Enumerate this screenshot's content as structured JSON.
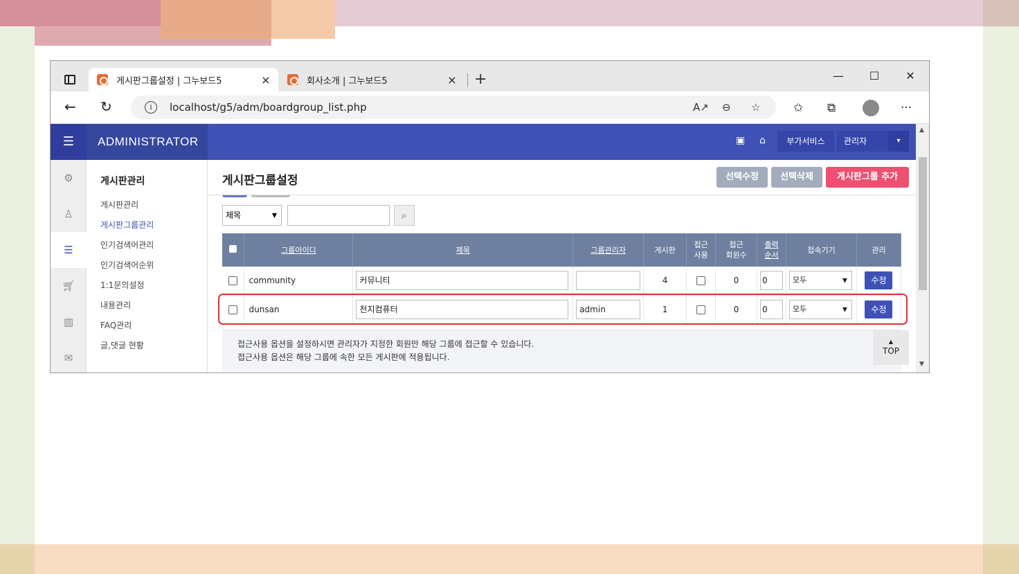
{
  "browser": {
    "tabs": [
      {
        "title": "게시판그룹설정 | 그누보드5",
        "close": "×"
      },
      {
        "title": "회사소개 | 그누보드5",
        "close": "×"
      }
    ],
    "new_tab": "+",
    "window_controls": {
      "minimize": "—",
      "maximize": "☐",
      "close": "✕"
    },
    "url": "localhost/g5/adm/boardgroup_list.php",
    "info_icon": "i"
  },
  "header": {
    "brand": "ADMINISTRATOR",
    "menu_icon": "☰",
    "addon_services": "부가서비스",
    "admin_menu": "관리자",
    "caret": "▾"
  },
  "sidebar": {
    "title": "게시판관리",
    "items": [
      {
        "label": "게시판관리"
      },
      {
        "label": "게시판그룹관리"
      },
      {
        "label": "인기검색어관리"
      },
      {
        "label": "인기검색어순위"
      },
      {
        "label": "1:1문의설정"
      },
      {
        "label": "내용관리"
      },
      {
        "label": "FAQ관리"
      },
      {
        "label": "글,댓글 현황"
      }
    ]
  },
  "main": {
    "title": "게시판그룹설정",
    "buttons": {
      "select_edit": "선택수정",
      "select_delete": "선택삭제",
      "add_group": "게시판그룹 추가"
    },
    "search": {
      "field_selected": "제목"
    },
    "table": {
      "headers": {
        "group_id": "그룹아이디",
        "subject": "제목",
        "group_admin": "그룹관리자",
        "board_count": "게시판",
        "access_use_1": "접근",
        "access_use_2": "사용",
        "access_members_1": "접근",
        "access_members_2": "회원수",
        "order_1": "출력",
        "order_2": "순서",
        "device": "접속기기",
        "manage": "관리"
      },
      "rows": [
        {
          "group_id": "community",
          "subject": "커뮤니티",
          "group_admin": "",
          "board_count": "4",
          "access_members": "0",
          "order": "0",
          "device": "모두",
          "edit": "수정"
        },
        {
          "group_id": "dunsan",
          "subject": "천지컴퓨터",
          "group_admin": "admin",
          "board_count": "1",
          "access_members": "0",
          "order": "0",
          "device": "모두",
          "edit": "수정"
        }
      ]
    },
    "notice": [
      "접근사용 옵션을 설정하시면 관리자가 지정한 회원만 해당 그룹에 접근할 수 있습니다.",
      "접근사용 옵션은 해당 그룹에 속한 모든 게시판에 적용됩니다."
    ],
    "top_link": "TOP",
    "top_arrow": "▲"
  },
  "colors": {
    "header": "#3f51b5",
    "highlight": "#e03030",
    "add_button": "#ef4f70",
    "gray_button": "#a2acbc"
  }
}
